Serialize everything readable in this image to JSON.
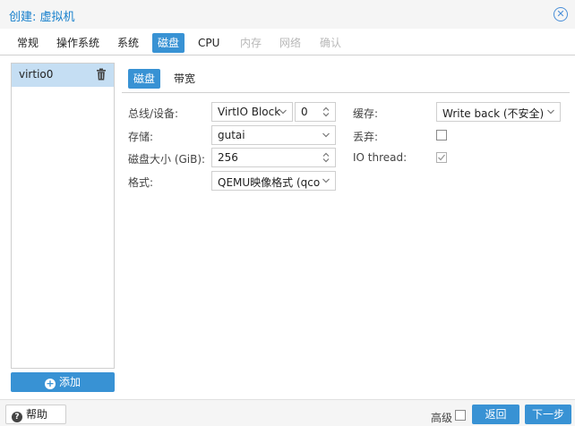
{
  "window": {
    "title": "创建: 虚拟机",
    "close_icon": "close-icon"
  },
  "tabs": [
    {
      "label": "常规",
      "state": "normal"
    },
    {
      "label": "操作系统",
      "state": "normal"
    },
    {
      "label": "系统",
      "state": "normal"
    },
    {
      "label": "磁盘",
      "state": "active"
    },
    {
      "label": "CPU",
      "state": "normal"
    },
    {
      "label": "内存",
      "state": "disabled"
    },
    {
      "label": "网络",
      "state": "disabled"
    },
    {
      "label": "确认",
      "state": "disabled"
    }
  ],
  "disk_list": {
    "items": [
      {
        "label": "virtio0",
        "selected": true
      }
    ],
    "add_label": "添加"
  },
  "subtabs": [
    {
      "label": "磁盘",
      "active": true
    },
    {
      "label": "带宽",
      "active": false
    }
  ],
  "form": {
    "bus_device": {
      "label": "总线/设备:",
      "bus": "VirtIO Block",
      "device": "0"
    },
    "storage": {
      "label": "存储:",
      "value": "gutai"
    },
    "disk_size": {
      "label": "磁盘大小 (GiB):",
      "value": "256"
    },
    "format": {
      "label": "格式:",
      "value": "QEMU映像格式 (qco"
    },
    "cache": {
      "label": "缓存:",
      "value": "Write back (不安全)"
    },
    "discard": {
      "label": "丢弃:",
      "checked": false
    },
    "io_thread": {
      "label": "IO thread:",
      "checked": true,
      "disabled": true
    }
  },
  "footer": {
    "help_label": "帮助",
    "advanced_label": "高级",
    "advanced_checked": false,
    "back_label": "返回",
    "next_label": "下一步"
  },
  "colors": {
    "accent": "#3892d4",
    "selection": "#c5def3",
    "title": "#157fcc"
  }
}
